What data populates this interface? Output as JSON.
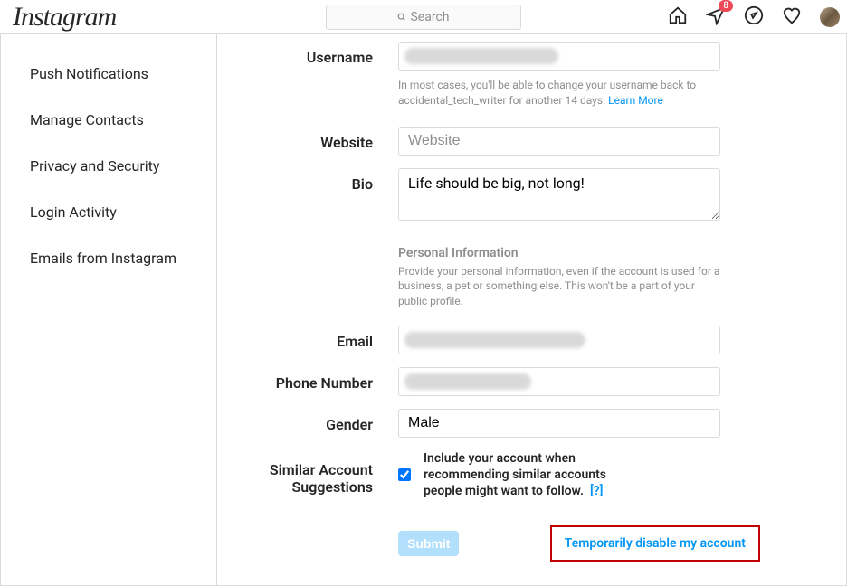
{
  "header": {
    "logo": "Instagram",
    "search_placeholder": "Search",
    "badge_count": "8"
  },
  "sidebar": {
    "items": [
      {
        "label": "Push Notifications"
      },
      {
        "label": "Manage Contacts"
      },
      {
        "label": "Privacy and Security"
      },
      {
        "label": "Login Activity"
      },
      {
        "label": "Emails from Instagram"
      }
    ]
  },
  "form": {
    "username": {
      "label": "Username",
      "helper_prefix": "In most cases, you'll be able to change your username back to accidental_tech_writer for another 14 days. ",
      "learn_more": "Learn More"
    },
    "website": {
      "label": "Website",
      "placeholder": "Website"
    },
    "bio": {
      "label": "Bio",
      "value": "Life should be big, not long!"
    },
    "personal_info": {
      "heading": "Personal Information",
      "desc": "Provide your personal information, even if the account is used for a business, a pet or something else. This won't be a part of your public profile."
    },
    "email": {
      "label": "Email"
    },
    "phone": {
      "label": "Phone Number"
    },
    "gender": {
      "label": "Gender",
      "value": "Male"
    },
    "similar": {
      "label": "Similar Account Suggestions",
      "checkbox_label": "Include your account when recommending similar accounts people might want to follow.",
      "help_link": "[?]"
    },
    "submit": "Submit",
    "disable": "Temporarily disable my account"
  }
}
